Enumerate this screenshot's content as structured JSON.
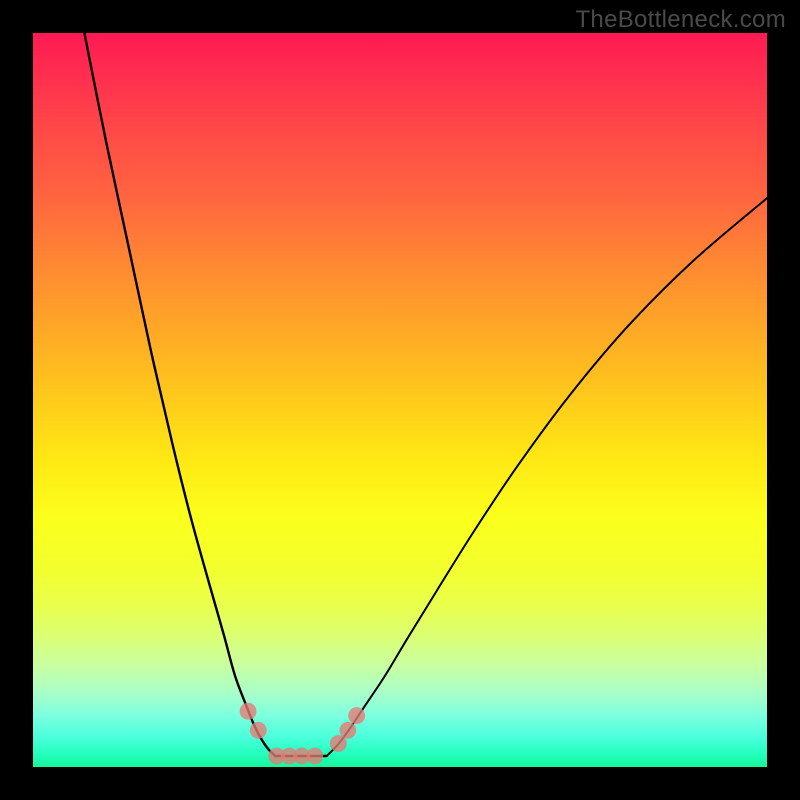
{
  "watermark": "TheBottleneck.com",
  "chart_data": {
    "type": "line",
    "title": "",
    "xlabel": "",
    "ylabel": "",
    "xlim": [
      0,
      100
    ],
    "ylim": [
      0,
      100
    ],
    "grid": false,
    "legend": false,
    "curve_left": {
      "x": [
        7.0,
        10.0,
        13.0,
        16.0,
        19.0,
        21.5,
        24.0,
        26.0,
        27.5,
        29.0,
        30.0,
        31.0,
        32.0,
        33.0
      ],
      "y": [
        100.0,
        85.0,
        71.0,
        57.0,
        44.0,
        34.0,
        25.0,
        18.0,
        12.5,
        8.5,
        6.0,
        4.0,
        2.5,
        1.5
      ]
    },
    "curve_right": {
      "x": [
        40.0,
        41.5,
        43.0,
        45.0,
        48.0,
        51.0,
        55.0,
        60.0,
        66.0,
        73.0,
        81.0,
        90.0,
        100.0
      ],
      "y": [
        1.5,
        3.0,
        5.0,
        8.0,
        12.5,
        17.5,
        24.0,
        32.0,
        41.0,
        50.5,
        60.0,
        69.0,
        77.5
      ]
    },
    "flat_segment": {
      "x": [
        33.0,
        40.0
      ],
      "y": [
        1.5,
        1.5
      ]
    },
    "markers": [
      {
        "x": 29.3,
        "y": 7.6,
        "r": 1.15
      },
      {
        "x": 30.7,
        "y": 5.0,
        "r": 1.15
      },
      {
        "x": 33.2,
        "y": 1.5,
        "r": 1.15
      },
      {
        "x": 34.9,
        "y": 1.5,
        "r": 1.15
      },
      {
        "x": 36.6,
        "y": 1.5,
        "r": 1.15
      },
      {
        "x": 38.4,
        "y": 1.5,
        "r": 1.15
      },
      {
        "x": 41.6,
        "y": 3.2,
        "r": 1.15
      },
      {
        "x": 42.9,
        "y": 5.0,
        "r": 1.15
      },
      {
        "x": 44.1,
        "y": 7.0,
        "r": 1.15
      }
    ],
    "colors": {
      "curve": "#000000",
      "marker": "#e77a73",
      "gradient_top": "#ff1a52",
      "gradient_bottom": "#15f79a"
    }
  }
}
